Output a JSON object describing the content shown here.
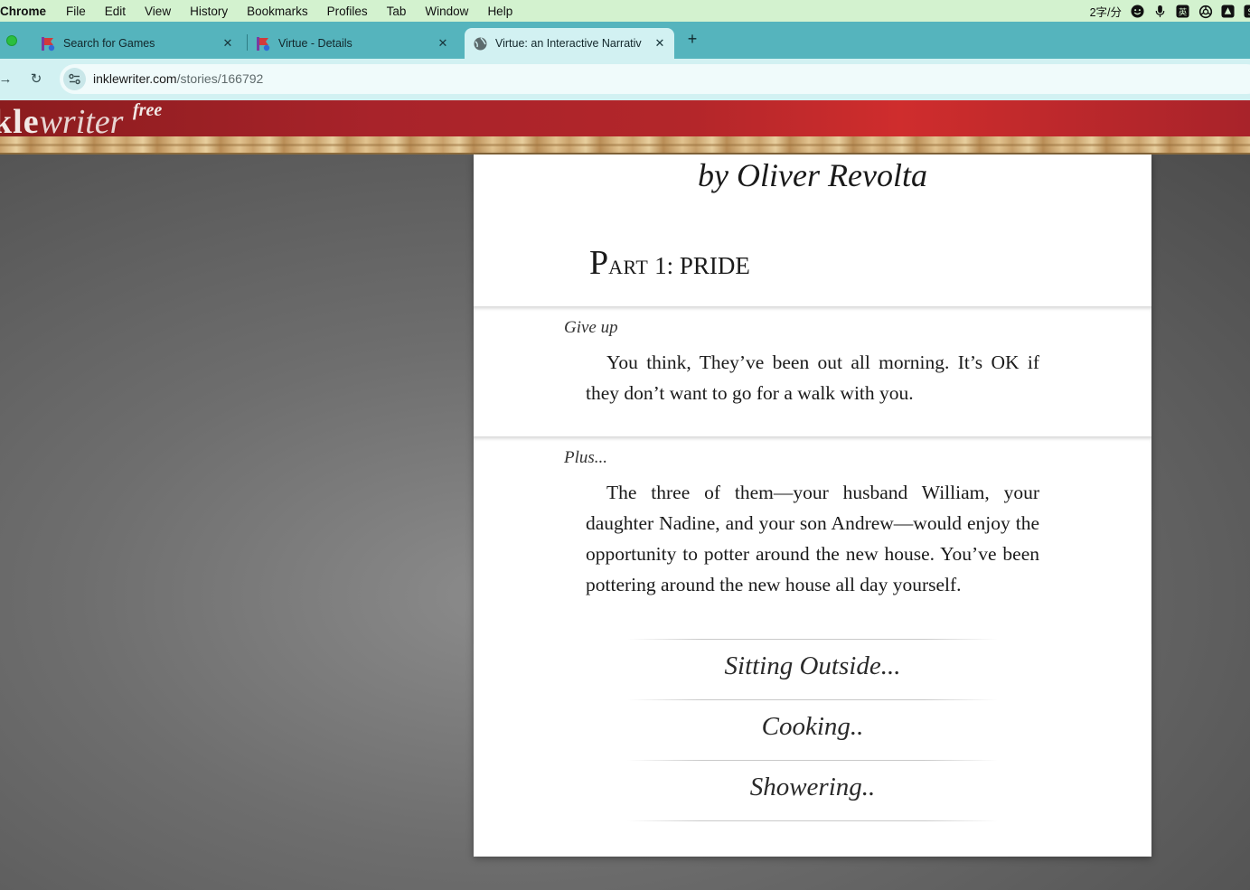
{
  "menubar": {
    "app": "Chrome",
    "items": [
      "File",
      "Edit",
      "View",
      "History",
      "Bookmarks",
      "Profiles",
      "Tab",
      "Window",
      "Help"
    ],
    "ime_text": "2字/分"
  },
  "tabs": [
    {
      "title": "Search for Games",
      "close": "✕"
    },
    {
      "title": "Virtue - Details",
      "close": "✕"
    },
    {
      "title": "Virtue: an Interactive Narrativ",
      "close": "✕"
    }
  ],
  "toolbar": {
    "new_tab": "+",
    "back": "→",
    "reload": "↻",
    "url_domain": "inklewriter.com",
    "url_path": "/stories/166792"
  },
  "header": {
    "logo_ink": "kle",
    "logo_writer": "writer",
    "logo_free": "free"
  },
  "story": {
    "byline": "by Oliver Revolta",
    "part_prefix_big": "P",
    "part_prefix_small": "ART",
    "part_rest": " 1: PRIDE",
    "sections": [
      {
        "label": "Give up",
        "text": "You think, They’ve been out all morning. It’s OK if they don’t want to go for a walk with you."
      },
      {
        "label": "Plus...",
        "text": "The three of them—your husband William, your daughter Nadine, and your son Andrew—would enjoy the opportunity to potter around the new house. You’ve been pottering around the new house all day yourself."
      }
    ],
    "choices": [
      "Sitting Outside...",
      "Cooking..",
      "Showering.."
    ]
  },
  "colors": {
    "menubar_bg": "#d3f2cf",
    "tabstrip_bg": "#55b4bd",
    "active_tab_bg": "#d2f1f2",
    "header_red": "#b3262a"
  }
}
